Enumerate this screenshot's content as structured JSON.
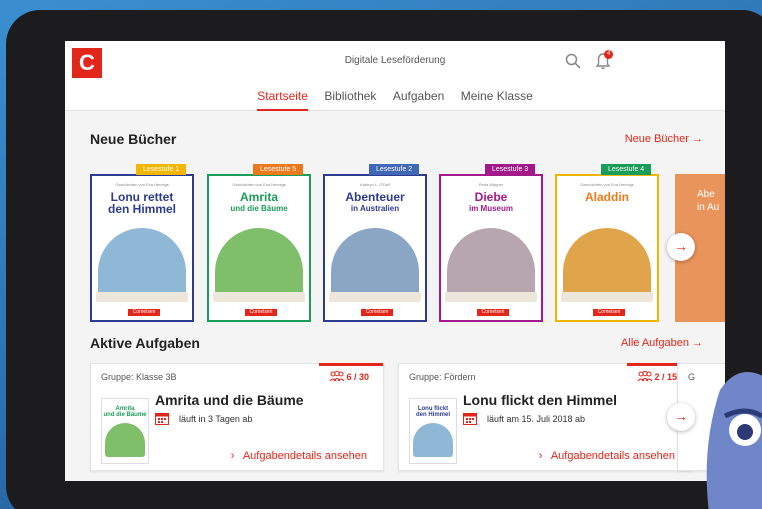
{
  "app": {
    "logo_letter": "C",
    "title": "Digitale Leseförderung",
    "notification_count": "4"
  },
  "nav": {
    "tabs": [
      {
        "label": "Startseite",
        "active": true
      },
      {
        "label": "Bibliothek",
        "active": false
      },
      {
        "label": "Aufgaben",
        "active": false
      },
      {
        "label": "Meine Klasse",
        "active": false
      }
    ]
  },
  "new_books": {
    "title": "Neue Bücher",
    "link": "Neue Bücher",
    "books": [
      {
        "badge": "Lesestufe 1",
        "badge_color": "#f2b600",
        "border_color": "#2e3b8f",
        "subtitle": "Geschichten von Eva Hennigs",
        "title_line1": "Lonu rettet",
        "title_line2": "den Himmel",
        "title_color": "#2e3b8f",
        "art_color": "#8fb7d6",
        "publisher": "Cornelsen"
      },
      {
        "badge": "Lesestufe 5",
        "badge_color": "#ec7a1c",
        "border_color": "#1a9c5a",
        "subtitle": "Geschichten von Eva Hennigs",
        "title_line1": "Amrita",
        "title_line2": "und die Bäume",
        "title_color": "#1a9c5a",
        "art_color": "#7fbf6a",
        "publisher": "Cornelsen"
      },
      {
        "badge": "Lesestufe 2",
        "badge_color": "#4168b7",
        "border_color": "#2e3b8f",
        "subtitle": "Kathryn L. O'Dell",
        "title_line1": "Abenteuer",
        "title_line2": "in Australien",
        "title_color": "#2e3b8f",
        "art_color": "#8aa6c4",
        "publisher": "Cornelsen"
      },
      {
        "badge": "Lesestufe 3",
        "badge_color": "#a21a8a",
        "border_color": "#a21a8a",
        "subtitle": "Petra Wagner",
        "title_line1": "Diebe",
        "title_line2": "im Museum",
        "title_color": "#a21a8a",
        "art_color": "#b7a6b0",
        "publisher": "Cornelsen"
      },
      {
        "badge": "Lesestufe 4",
        "badge_color": "#1a9c5a",
        "border_color": "#f2b600",
        "subtitle": "Geschichten von Eva Hennigs",
        "title_line1": "Aladdin",
        "title_line2": "",
        "title_color": "#ec7a1c",
        "art_color": "#e0a44a",
        "publisher": "Cornelsen"
      }
    ],
    "partial_book_text": "Abe\nin Au"
  },
  "active_tasks": {
    "title": "Aktive Aufgaben",
    "link": "Alle Aufgaben",
    "cards": [
      {
        "group": "Gruppe: Klasse 3B",
        "count": "6 / 30",
        "book_title": "Amrita und die Bäume",
        "thumb_title": "Amrita\nund die Bäume",
        "thumb_color": "#1a9c5a",
        "thumb_art": "#7fbf6a",
        "due": "läuft in 3 Tagen ab",
        "details": "Aufgabendetails ansehen"
      },
      {
        "group": "Gruppe: Fördern",
        "count": "2 / 15",
        "book_title": "Lonu flickt den Himmel",
        "thumb_title": "Lonu flickt\nden Himmel",
        "thumb_color": "#2e3b8f",
        "thumb_art": "#8fb7d6",
        "due": "läuft am 15. Juli 2018 ab",
        "details": "Aufgabendetails ansehen"
      }
    ],
    "partial_card_text": "G"
  },
  "icons": {
    "search": "search-icon",
    "bell": "bell-icon",
    "arrow": "arrow-right-icon",
    "group": "group-icon",
    "calendar": "calendar-icon"
  },
  "colors": {
    "accent": "#e3261a"
  }
}
